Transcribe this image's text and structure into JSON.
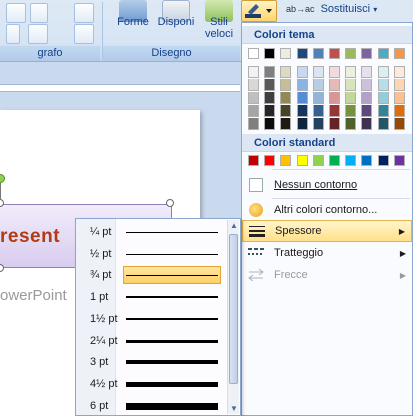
{
  "ribbon": {
    "groups": {
      "paragraph_partial": "grafo",
      "drawing": "Disegno"
    },
    "buttons": {
      "shapes": "Forme",
      "arrange": "Disponi",
      "styles_line1": "Stili",
      "styles_line2": "veloci"
    },
    "replace": "Sostituisci"
  },
  "slide": {
    "shape_text": "resent",
    "subtitle_text": "owerPoint"
  },
  "color_menu": {
    "theme_header": "Colori tema",
    "standard_header": "Colori standard",
    "theme_top": [
      "#ffffff",
      "#000000",
      "#eeece1",
      "#1f497d",
      "#4f81bd",
      "#c0504d",
      "#9bbb59",
      "#8064a2",
      "#4bacc6",
      "#f79646"
    ],
    "theme_shades": [
      [
        "#f2f2f2",
        "#d8d8d8",
        "#bfbfbf",
        "#a5a5a5",
        "#7f7f7f"
      ],
      [
        "#7f7f7f",
        "#595959",
        "#3f3f3f",
        "#262626",
        "#0c0c0c"
      ],
      [
        "#ddd9c3",
        "#c4bd97",
        "#938953",
        "#494429",
        "#1d1b10"
      ],
      [
        "#c6d9f0",
        "#8db3e2",
        "#548dd4",
        "#17365d",
        "#0f243e"
      ],
      [
        "#dbe5f1",
        "#b8cce4",
        "#95b3d7",
        "#366092",
        "#244061"
      ],
      [
        "#f2dcdb",
        "#e5b9b7",
        "#d99694",
        "#953734",
        "#632423"
      ],
      [
        "#ebf1dd",
        "#d7e3bc",
        "#c3d69b",
        "#76923c",
        "#4f6128"
      ],
      [
        "#e5e0ec",
        "#ccc1d9",
        "#b2a2c7",
        "#5f497a",
        "#3f3151"
      ],
      [
        "#dbeef3",
        "#b7dde8",
        "#92cddc",
        "#31859b",
        "#205867"
      ],
      [
        "#fdeada",
        "#fbd5b5",
        "#fac08f",
        "#e36c09",
        "#974806"
      ]
    ],
    "standard": [
      "#c00000",
      "#ff0000",
      "#ffc000",
      "#ffff00",
      "#92d050",
      "#00b050",
      "#00b0f0",
      "#0070c0",
      "#002060",
      "#7030a0"
    ],
    "items": {
      "no_outline": "Nessun contorno",
      "more_colors": "Altri colori contorno...",
      "weight": "Spessore",
      "dashes": "Tratteggio",
      "arrows": "Frecce"
    }
  },
  "weight_menu": {
    "options": [
      {
        "label": "¼ pt",
        "selected": false
      },
      {
        "label": "½ pt",
        "selected": false
      },
      {
        "label": "¾ pt",
        "selected": true
      },
      {
        "label": "1 pt",
        "selected": false
      },
      {
        "label": "1½ pt",
        "selected": false
      },
      {
        "label": "2¼ pt",
        "selected": false
      },
      {
        "label": "3 pt",
        "selected": false
      },
      {
        "label": "4½ pt",
        "selected": false
      },
      {
        "label": "6 pt",
        "selected": false
      }
    ]
  }
}
